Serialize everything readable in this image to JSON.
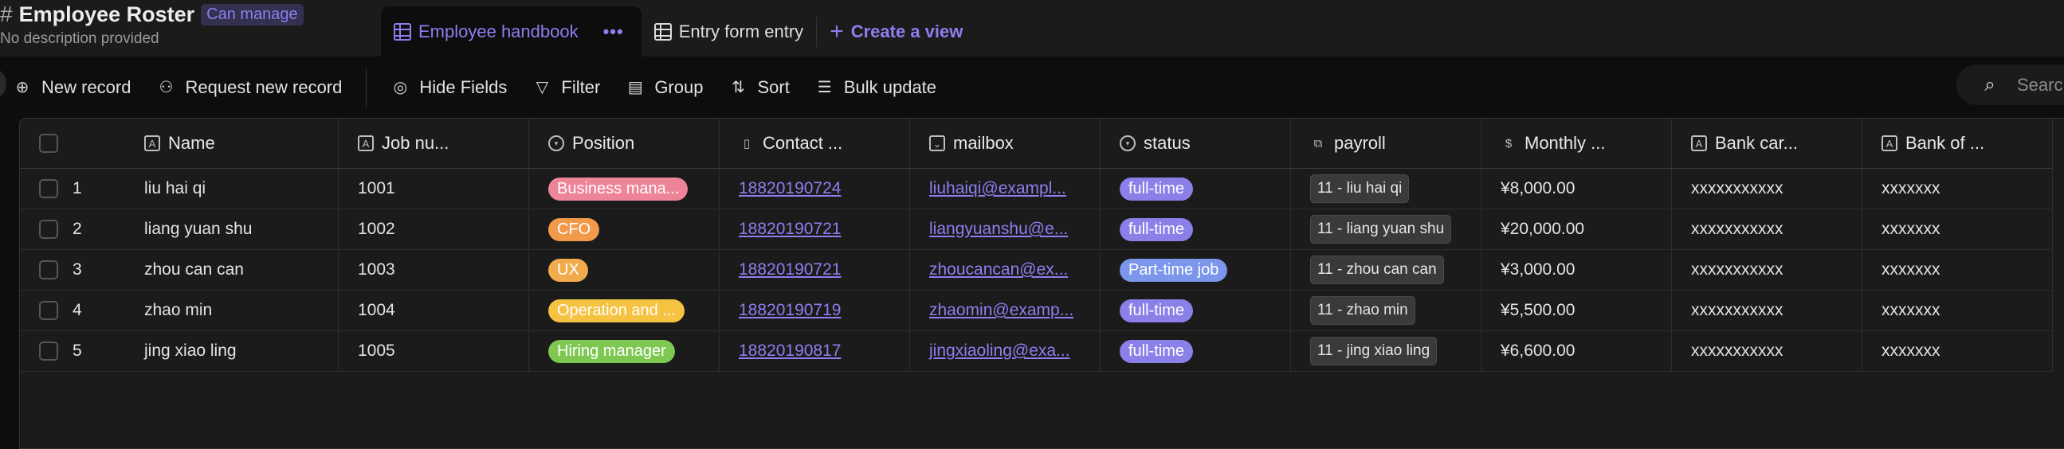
{
  "header": {
    "title": "Employee Roster",
    "permission_badge": "Can manage",
    "description": "No description provided"
  },
  "views": {
    "active": "Employee handbook",
    "more": "•••",
    "other": "Entry form entry",
    "create": "Create a view"
  },
  "toolbar": {
    "new_record": "New record",
    "request_new_record": "Request new record",
    "hide_fields": "Hide Fields",
    "filter": "Filter",
    "group": "Group",
    "sort": "Sort",
    "bulk_update": "Bulk update",
    "search_placeholder": "Search"
  },
  "columns": [
    {
      "label": "Name",
      "icon": "text-field-icon"
    },
    {
      "label": "Job nu...",
      "icon": "text-field-icon"
    },
    {
      "label": "Position",
      "icon": "single-select-icon"
    },
    {
      "label": "Contact ...",
      "icon": "phone-icon"
    },
    {
      "label": "mailbox",
      "icon": "email-icon"
    },
    {
      "label": "status",
      "icon": "single-select-icon"
    },
    {
      "label": "payroll",
      "icon": "link-record-icon"
    },
    {
      "label": "Monthly ...",
      "icon": "currency-icon"
    },
    {
      "label": "Bank car...",
      "icon": "text-field-icon"
    },
    {
      "label": "Bank of ...",
      "icon": "text-field-icon"
    }
  ],
  "rows": [
    {
      "num": "1",
      "name": "liu hai qi",
      "job": "1001",
      "position": "Business mana...",
      "position_color": "#ee8497",
      "contact": "18820190724",
      "mailbox": "liuhaiqi@exampl...",
      "status": "full-time",
      "status_color": "#8b7fe8",
      "payroll": "11 - liu hai qi",
      "monthly": "¥8,000.00",
      "bank_card": "xxxxxxxxxxx",
      "bank_of": "xxxxxxx"
    },
    {
      "num": "2",
      "name": "liang yuan shu",
      "job": "1002",
      "position": "CFO",
      "position_color": "#f09a4a",
      "contact": "18820190721",
      "mailbox": "liangyuanshu@e...",
      "status": "full-time",
      "status_color": "#8b7fe8",
      "payroll": "11 - liang yuan shu",
      "monthly": "¥20,000.00",
      "bank_card": "xxxxxxxxxxx",
      "bank_of": "xxxxxxx"
    },
    {
      "num": "3",
      "name": "zhou can can",
      "job": "1003",
      "position": "UX",
      "position_color": "#f2ab4c",
      "contact": "18820190721",
      "mailbox": "zhoucancan@ex...",
      "status": "Part-time job",
      "status_color": "#7b96ea",
      "payroll": "11 - zhou can can",
      "monthly": "¥3,000.00",
      "bank_card": "xxxxxxxxxxx",
      "bank_of": "xxxxxxx"
    },
    {
      "num": "4",
      "name": "zhao min",
      "job": "1004",
      "position": "Operation and ...",
      "position_color": "#f5c242",
      "contact": "18820190719",
      "mailbox": "zhaomin@examp...",
      "status": "full-time",
      "status_color": "#8b7fe8",
      "payroll": "11 - zhao min",
      "monthly": "¥5,500.00",
      "bank_card": "xxxxxxxxxxx",
      "bank_of": "xxxxxxx"
    },
    {
      "num": "5",
      "name": "jing xiao ling",
      "job": "1005",
      "position": "Hiring manager",
      "position_color": "#7ec852",
      "contact": "18820190817",
      "mailbox": "jingxiaoling@exa...",
      "status": "full-time",
      "status_color": "#8b7fe8",
      "payroll": "11 - jing xiao ling",
      "monthly": "¥6,600.00",
      "bank_card": "xxxxxxxxxxx",
      "bank_of": "xxxxxxx"
    }
  ]
}
